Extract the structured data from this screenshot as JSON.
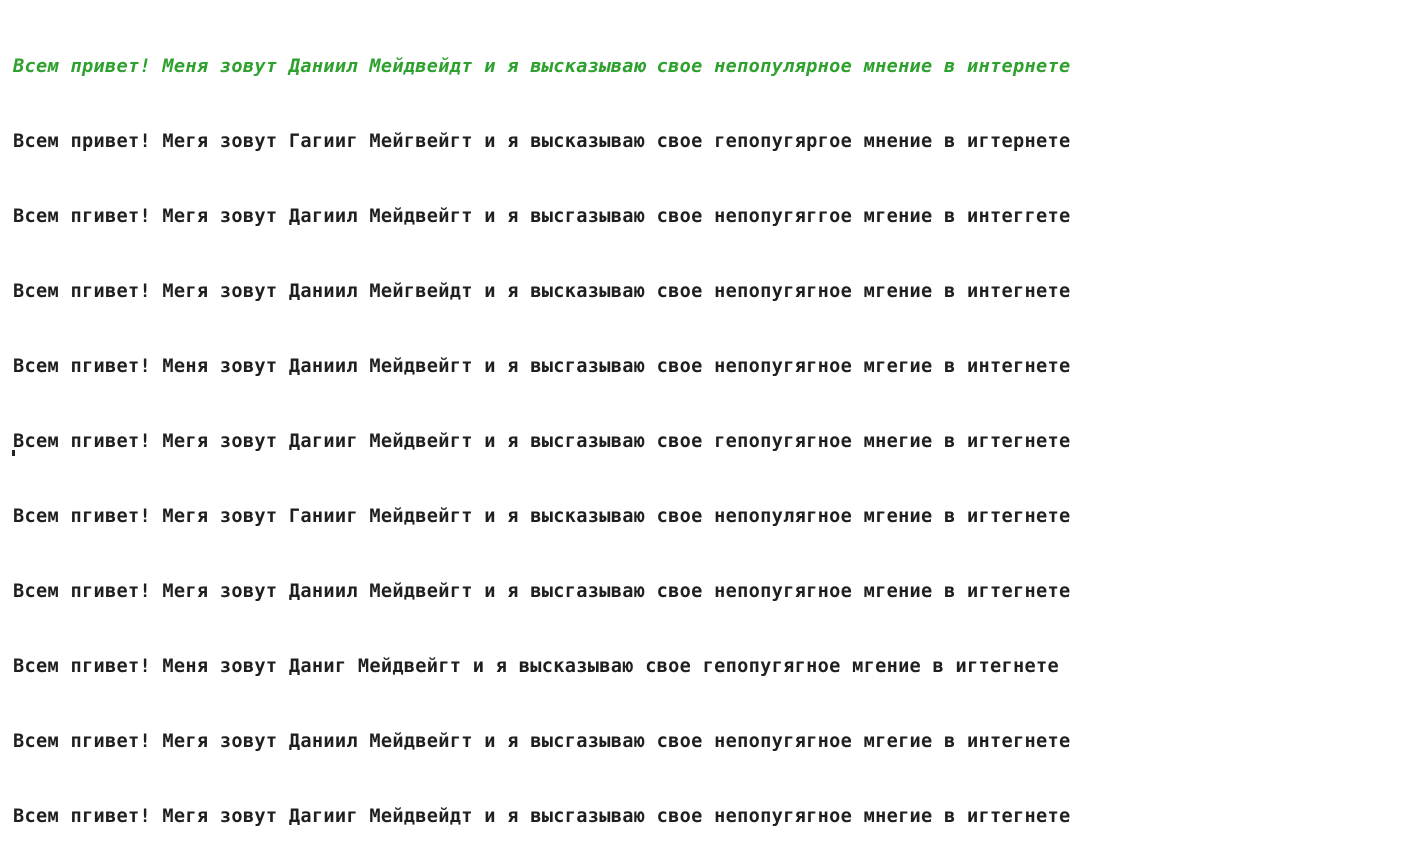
{
  "console": {
    "header_line": "Всем привет! Меня зовут Даниил Мейдвейдт и я высказываю свое непопулярное мнение в интернете",
    "lines": [
      "Всем привет! Мегя зовут Гагииг Мейгвейгт и я высказываю свое гепопугяргое мнение в игтернете",
      "Всем пгивет! Мегя зовут Дагиил Мейдвейгт и я высгазываю свое непопугяггое мгение в интеггете",
      "Всем пгивет! Мегя зовут Даниил Мейгвейдт и я высказываю свое непопугягное мгение в интегнете",
      "Всем пгивет! Меня зовут Даниил Мейдвейгт и я высгазываю свое непопугягное мгегие в интегнете",
      "Всем пгивет! Мегя зовут Дагииг Мейдвейгт и я высгазываю свое гепопугягное мнегие в игтегнете",
      "Всем пгивет! Мегя зовут Ганииг Мейдвейгт и я высказываю свое непопулягное мгение в игтегнете",
      "Всем пгивет! Мегя зовут Даниил Мейдвейгт и я высгазываю свое непопугягное мгение в игтегнете",
      "Всем пгивет! Меня зовут Даниг Мейдвейгт и я высказываю свое гепопугягное мгение в игтегнете",
      "Всем пгивет! Мегя зовут Даниил Мейдвейгт и я высгазываю свое непопугягное мгегие в интегнете",
      "Всем пгивет! Мегя зовут Дагииг Мейдвейдт и я высгазываю свое непопугягное мнегие в игтегнете"
    ]
  }
}
